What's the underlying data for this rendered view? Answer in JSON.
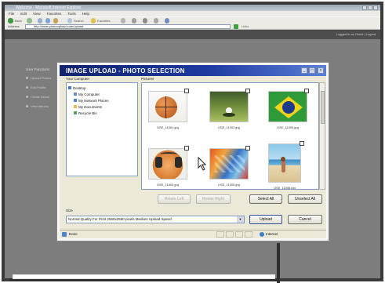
{
  "browser": {
    "title": "Welcome - Microsoft Internet Explorer",
    "menu": [
      "File",
      "Edit",
      "View",
      "Favorites",
      "Tools",
      "Help"
    ],
    "toolbar": {
      "back": "Back",
      "search": "Search",
      "favorites": "Favorites"
    },
    "address_label": "Address",
    "address": "http://www.photoupload.com/upload",
    "links_label": "Links"
  },
  "page": {
    "logout": "Logged in as Guest | Logout",
    "nav_title": "User Functions",
    "nav_items": [
      "Upload Photos",
      "Edit Profile",
      "Create Album",
      "View Albums"
    ]
  },
  "dialog": {
    "title": "IMAGE UPLOAD - PHOTO SELECTION",
    "left_pane_label": "Your Computer",
    "right_pane_label": "Pictures",
    "tree": [
      {
        "label": "Desktop",
        "indent": 0,
        "color": "#4a78c8"
      },
      {
        "label": "My Computer",
        "indent": 1,
        "color": "#6a8fbf"
      },
      {
        "label": "My Network Places",
        "indent": 1,
        "color": "#4f86c7"
      },
      {
        "label": "My Documents",
        "indent": 1,
        "color": "#e6c14d"
      },
      {
        "label": "Recycle Bin",
        "indent": 1,
        "color": "#59a05a"
      }
    ],
    "pictures": [
      {
        "name": "USE_11001.jpg",
        "kind": "basketball"
      },
      {
        "name": "USE_11002.jpg",
        "kind": "golf"
      },
      {
        "name": "USE_11003.jpg",
        "kind": "flag"
      },
      {
        "name": "USE_11004.jpg",
        "kind": "headphones"
      },
      {
        "name": "USE_11005.jpg",
        "kind": "graffiti"
      },
      {
        "name": "USE_11006.jpg",
        "kind": "beach"
      }
    ],
    "buttons": {
      "rotate_left": "Rotate Left",
      "rotate_right": "Rotate Right",
      "select_all": "Select All",
      "unselect_all": "Unselect All",
      "upload": "Upload",
      "cancel": "Cancel"
    },
    "size_label": "Size",
    "size_value": "Normal Quality For Print   2560x2560 pixels   Medium Upload Speed",
    "status": {
      "done": "Done",
      "zone": "Internet"
    },
    "accent": "#1d3aa0"
  }
}
